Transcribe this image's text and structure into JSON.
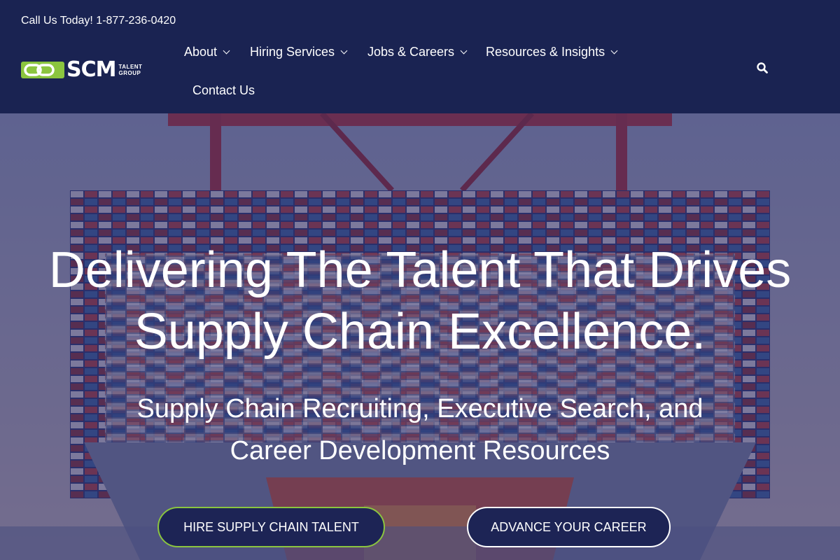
{
  "topbar": {
    "phone": "Call Us Today! 1-877-236-0420"
  },
  "logo": {
    "word": "SCM",
    "tag_top": "TALENT",
    "tag_bottom": "GROUP"
  },
  "nav": {
    "items": [
      {
        "label": "About",
        "has_dropdown": true
      },
      {
        "label": "Hiring Services",
        "has_dropdown": true
      },
      {
        "label": "Jobs & Careers",
        "has_dropdown": true
      },
      {
        "label": "Resources & Insights",
        "has_dropdown": true
      },
      {
        "label": "Contact Us",
        "has_dropdown": false
      }
    ],
    "search_icon": "search-icon"
  },
  "hero": {
    "headline_line1": "Delivering The Talent That Drives",
    "headline_line2": "Supply Chain Excellence.",
    "sub_line1": "Supply Chain Recruiting, Executive Search, and",
    "sub_line2": "Career Development Resources",
    "cta_hire": "HIRE SUPPLY CHAIN TALENT",
    "cta_career": "ADVANCE YOUR CAREER"
  },
  "colors": {
    "header_bg": "#1a2352",
    "overlay": "#28246e",
    "accent_green": "#8bc53f",
    "button_bg": "#1d2455"
  }
}
